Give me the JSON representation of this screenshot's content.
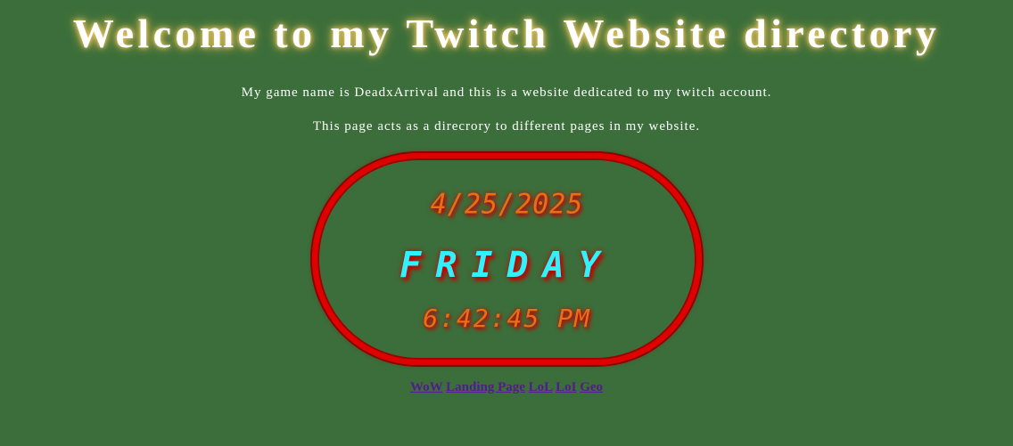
{
  "page": {
    "title": "Welcome to my Twitch Website directory",
    "intro_line_1": "My game name is DeadxArrival and this is a website dedicated to my twitch account.",
    "intro_line_2": "This page acts as a direcrory to different pages in my website."
  },
  "clock": {
    "date": "4/25/2025",
    "day": "FRIDAY",
    "time": "6:42:45 PM"
  },
  "nav": {
    "links": [
      {
        "label": "WoW"
      },
      {
        "label": "Landing Page"
      },
      {
        "label": "LoL"
      },
      {
        "label": "LoI"
      },
      {
        "label": "Geo"
      }
    ]
  },
  "colors": {
    "background": "#3b6e3a",
    "clock_border": "#e10000",
    "clock_digits": "#e76f18",
    "clock_day": "#2ff2ff",
    "link": "#551a8b"
  }
}
